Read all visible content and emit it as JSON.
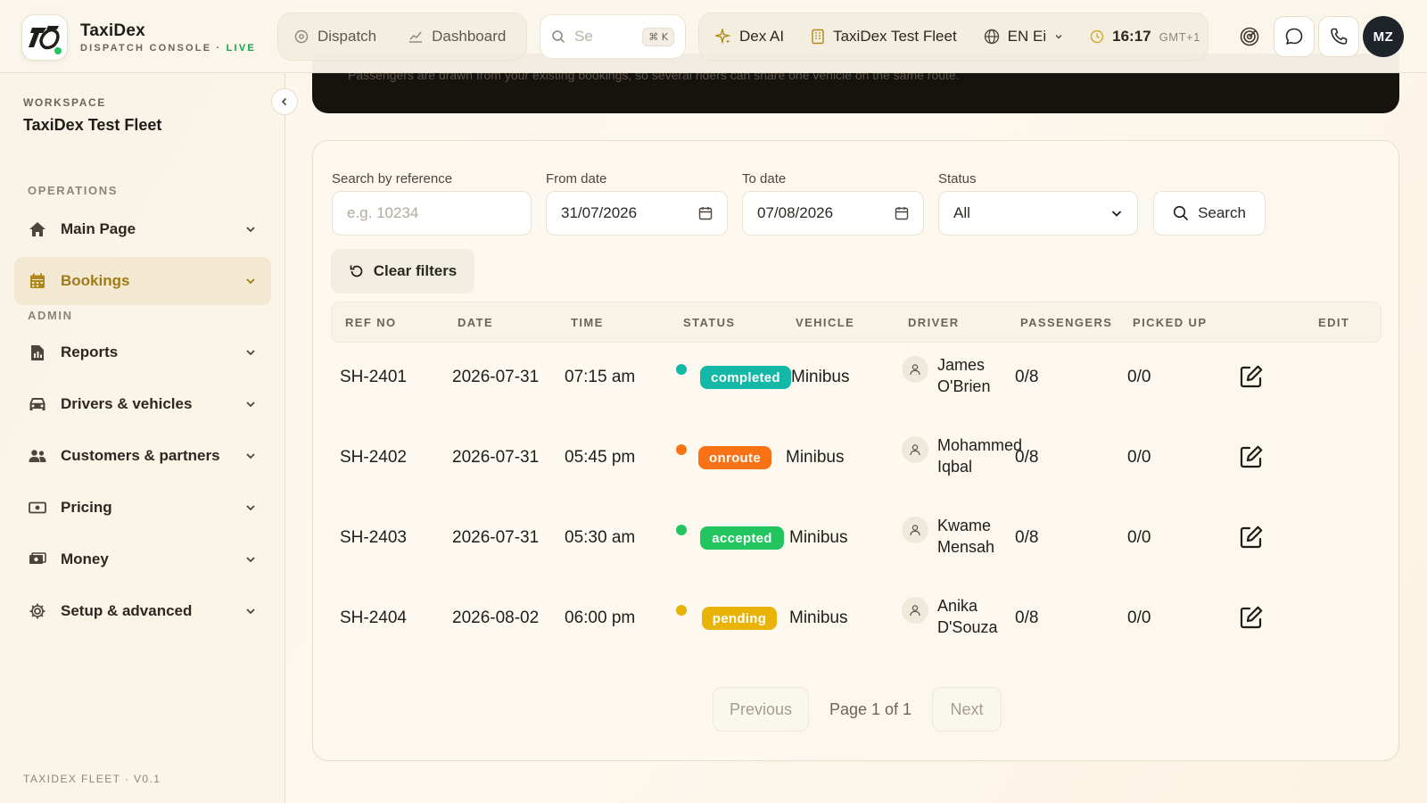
{
  "app": {
    "name": "TaxiDex",
    "subtitle": "DISPATCH CONSOLE",
    "live_label": "LIVE"
  },
  "topnav": {
    "dispatch": "Dispatch",
    "dashboard": "Dashboard"
  },
  "search": {
    "placeholder": "Se",
    "shortcut": "⌘ K"
  },
  "tools": {
    "ai": "Dex AI",
    "fleet": "TaxiDex Test Fleet",
    "language": "EN Ei",
    "time": "16:17",
    "timezone": "GMT+1"
  },
  "user": {
    "initials": "MZ"
  },
  "sidebar": {
    "workspace_label": "WORKSPACE",
    "workspace_name": "TaxiDex Test Fleet",
    "operations_label": "OPERATIONS",
    "admin_label": "ADMIN",
    "items": [
      {
        "label": "Main Page",
        "icon": "home-icon"
      },
      {
        "label": "Bookings",
        "icon": "calendar-icon",
        "active": true
      },
      {
        "label": "Reports",
        "icon": "report-icon"
      },
      {
        "label": "Drivers & vehicles",
        "icon": "car-icon"
      },
      {
        "label": "Customers & partners",
        "icon": "users-icon"
      },
      {
        "label": "Pricing",
        "icon": "cash-icon"
      },
      {
        "label": "Money",
        "icon": "money-icon"
      },
      {
        "label": "Setup & advanced",
        "icon": "gear-icon"
      }
    ],
    "version": "TAXIDEX FLEET · V0.1"
  },
  "banner": {
    "text": "Passengers are drawn from your existing bookings, so several riders can share one vehicle on the same route."
  },
  "filters": {
    "reference_label": "Search by reference",
    "reference_placeholder": "e.g. 10234",
    "from_label": "From date",
    "from_value": "31/07/2026",
    "to_label": "To date",
    "to_value": "07/08/2026",
    "status_label": "Status",
    "status_value": "All",
    "search_button": "Search",
    "clear_button": "Clear filters"
  },
  "table": {
    "headers": [
      "REF NO",
      "DATE",
      "TIME",
      "STATUS",
      "VEHICLE",
      "DRIVER",
      "PASSENGERS",
      "PICKED UP",
      "EDIT"
    ],
    "rows": [
      {
        "ref": "SH-2401",
        "date": "2026-07-31",
        "time": "07:15 am",
        "status": "completed",
        "status_color": "#14b8a6",
        "vehicle": "Minibus",
        "driver": "James O'Brien",
        "passengers": "0/8",
        "picked_up": "0/0"
      },
      {
        "ref": "SH-2402",
        "date": "2026-07-31",
        "time": "05:45 pm",
        "status": "onroute",
        "status_color": "#f97316",
        "vehicle": "Minibus",
        "driver": "Mohammed Iqbal",
        "passengers": "0/8",
        "picked_up": "0/0"
      },
      {
        "ref": "SH-2403",
        "date": "2026-07-31",
        "time": "05:30 am",
        "status": "accepted",
        "status_color": "#22c55e",
        "vehicle": "Minibus",
        "driver": "Kwame Mensah",
        "passengers": "0/8",
        "picked_up": "0/0"
      },
      {
        "ref": "SH-2404",
        "date": "2026-08-02",
        "time": "06:00 pm",
        "status": "pending",
        "status_color": "#eab308",
        "vehicle": "Minibus",
        "driver": "Anika D'Souza",
        "passengers": "0/8",
        "picked_up": "0/0"
      }
    ]
  },
  "pagination": {
    "previous": "Previous",
    "info": "Page 1 of 1",
    "next": "Next"
  }
}
